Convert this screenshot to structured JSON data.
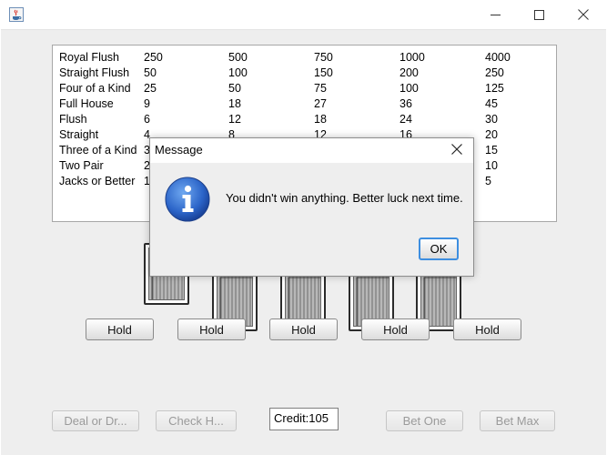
{
  "window": {
    "app_icon": "java-cup-icon",
    "controls": [
      "minimize-icon",
      "maximize-icon",
      "close-icon"
    ]
  },
  "paytable": {
    "rows": [
      {
        "hand": "Royal Flush",
        "payouts": [
          "250",
          "500",
          "750",
          "1000",
          "4000"
        ]
      },
      {
        "hand": "Straight Flush",
        "payouts": [
          "50",
          "100",
          "150",
          "200",
          "250"
        ]
      },
      {
        "hand": "Four of a Kind",
        "payouts": [
          "25",
          "50",
          "75",
          "100",
          "125"
        ]
      },
      {
        "hand": "Full House",
        "payouts": [
          "9",
          "18",
          "27",
          "36",
          "45"
        ]
      },
      {
        "hand": "Flush",
        "payouts": [
          "6",
          "12",
          "18",
          "24",
          "30"
        ]
      },
      {
        "hand": "Straight",
        "payouts": [
          "4",
          "8",
          "12",
          "16",
          "20"
        ]
      },
      {
        "hand": "Three of a Kind",
        "payouts": [
          "3",
          "",
          "",
          "",
          "15"
        ]
      },
      {
        "hand": "Two Pair",
        "payouts": [
          "2",
          "",
          "",
          "",
          "10"
        ]
      },
      {
        "hand": "Jacks or Better",
        "payouts": [
          "1",
          "",
          "",
          "",
          "5"
        ]
      }
    ]
  },
  "hold_buttons": [
    "Hold",
    "Hold",
    "Hold",
    "Hold",
    "Hold"
  ],
  "controls": {
    "deal_label": "Deal or Dr...",
    "check_label": "Check H...",
    "credit_value": "Credit:105",
    "bet_one_label": "Bet One",
    "bet_max_label": "Bet Max"
  },
  "dialog": {
    "title": "Message",
    "icon": "information-icon",
    "message": "You didn't win anything. Better luck next time.",
    "ok_label": "OK"
  }
}
